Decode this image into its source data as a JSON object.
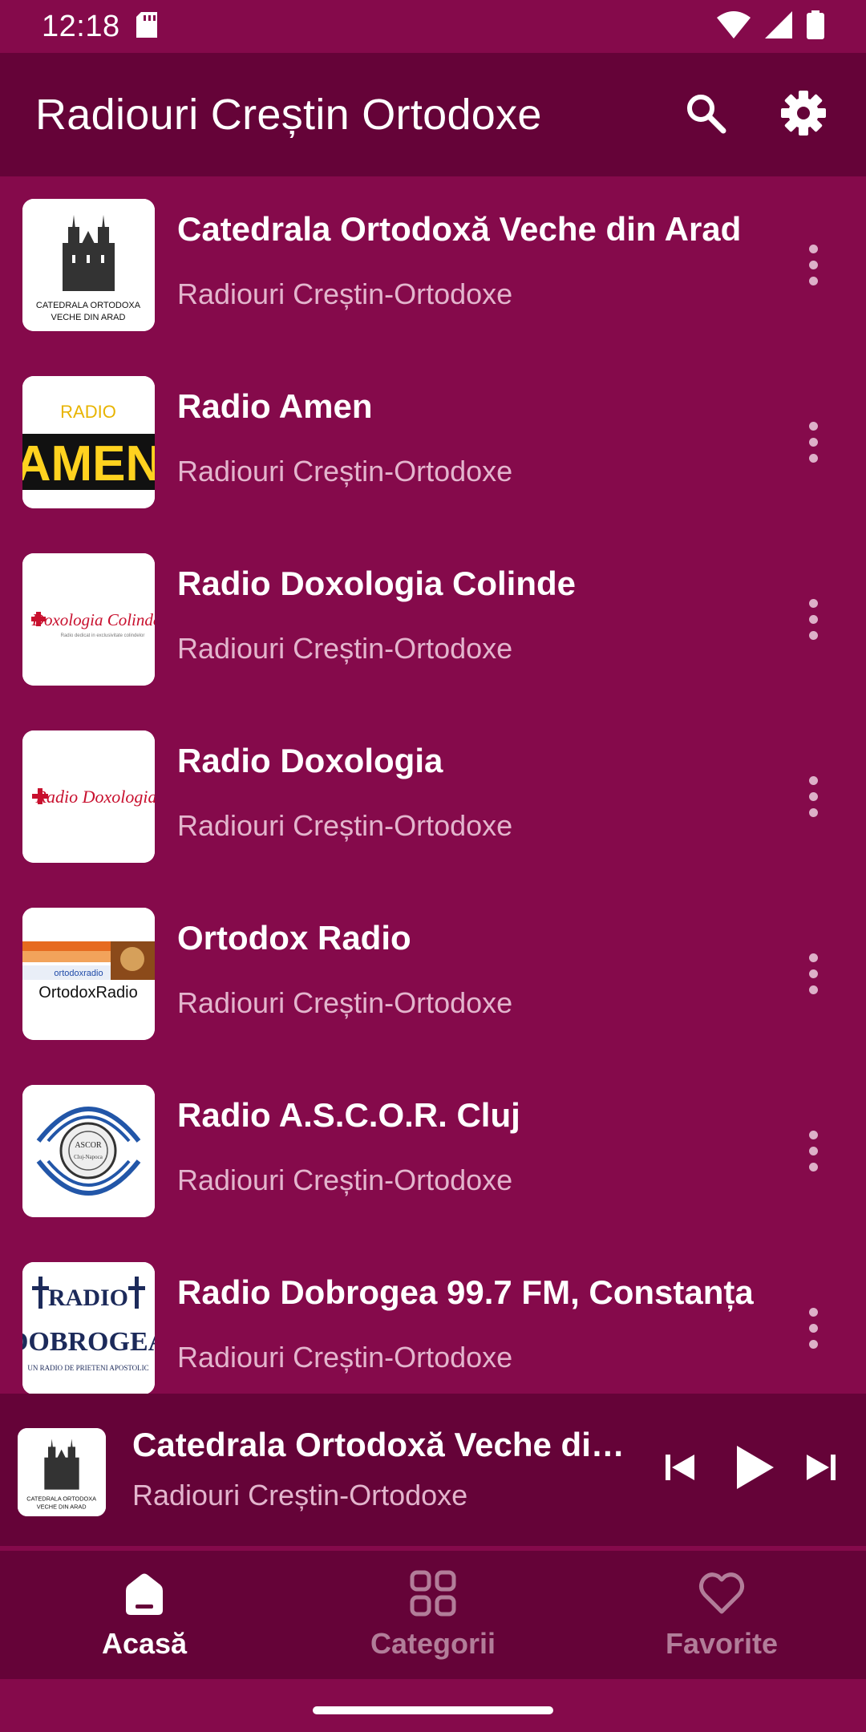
{
  "status_bar": {
    "time": "12:18"
  },
  "app_bar": {
    "title": "Radiouri Creștin Ortodoxe",
    "search_icon": "search-icon",
    "settings_icon": "gear-icon"
  },
  "stations": [
    {
      "title": "Catedrala Ortodoxă Veche din Arad",
      "subtitle": "Radiouri Creștin-Ortodoxe",
      "logo_text": "CATEDRALA ORTODOXA VECHE DIN ARAD"
    },
    {
      "title": "Radio Amen",
      "subtitle": "Radiouri Creștin-Ortodoxe",
      "logo_text_small": "RADIO",
      "logo_text_big": "AMEN"
    },
    {
      "title": "Radio Doxologia Colinde",
      "subtitle": "Radiouri Creștin-Ortodoxe",
      "logo_text": "Doxologia Colinde"
    },
    {
      "title": "Radio Doxologia",
      "subtitle": "Radiouri Creștin-Ortodoxe",
      "logo_text": "Radio Doxologia"
    },
    {
      "title": "Ortodox Radio",
      "subtitle": "Radiouri Creștin-Ortodoxe",
      "logo_text": "OrtodoxRadio"
    },
    {
      "title": "Radio A.S.C.O.R. Cluj",
      "subtitle": "Radiouri Creștin-Ortodoxe",
      "logo_text": "ASCOR"
    },
    {
      "title": "Radio Dobrogea 99.7 FM, Constanța",
      "subtitle": "Radiouri Creștin-Ortodoxe",
      "logo_text_top": "RADIO",
      "logo_text_big": "DOBROGEA"
    }
  ],
  "player": {
    "title": "Catedrala Ortodoxă Veche din Arad",
    "subtitle": "Radiouri Creștin-Ortodoxe",
    "logo_text": "CATEDRALA ORTODOXA VECHE DIN ARAD"
  },
  "bottom_nav": {
    "items": [
      {
        "label": "Acasă",
        "icon": "home-icon",
        "active": true
      },
      {
        "label": "Categorii",
        "icon": "grid-icon",
        "active": false
      },
      {
        "label": "Favorite",
        "icon": "heart-icon",
        "active": false
      }
    ]
  },
  "colors": {
    "background": "#850a4b",
    "app_bar": "#650338",
    "subtitle": "#e3b5cd",
    "inactive_nav": "#b27d99"
  }
}
